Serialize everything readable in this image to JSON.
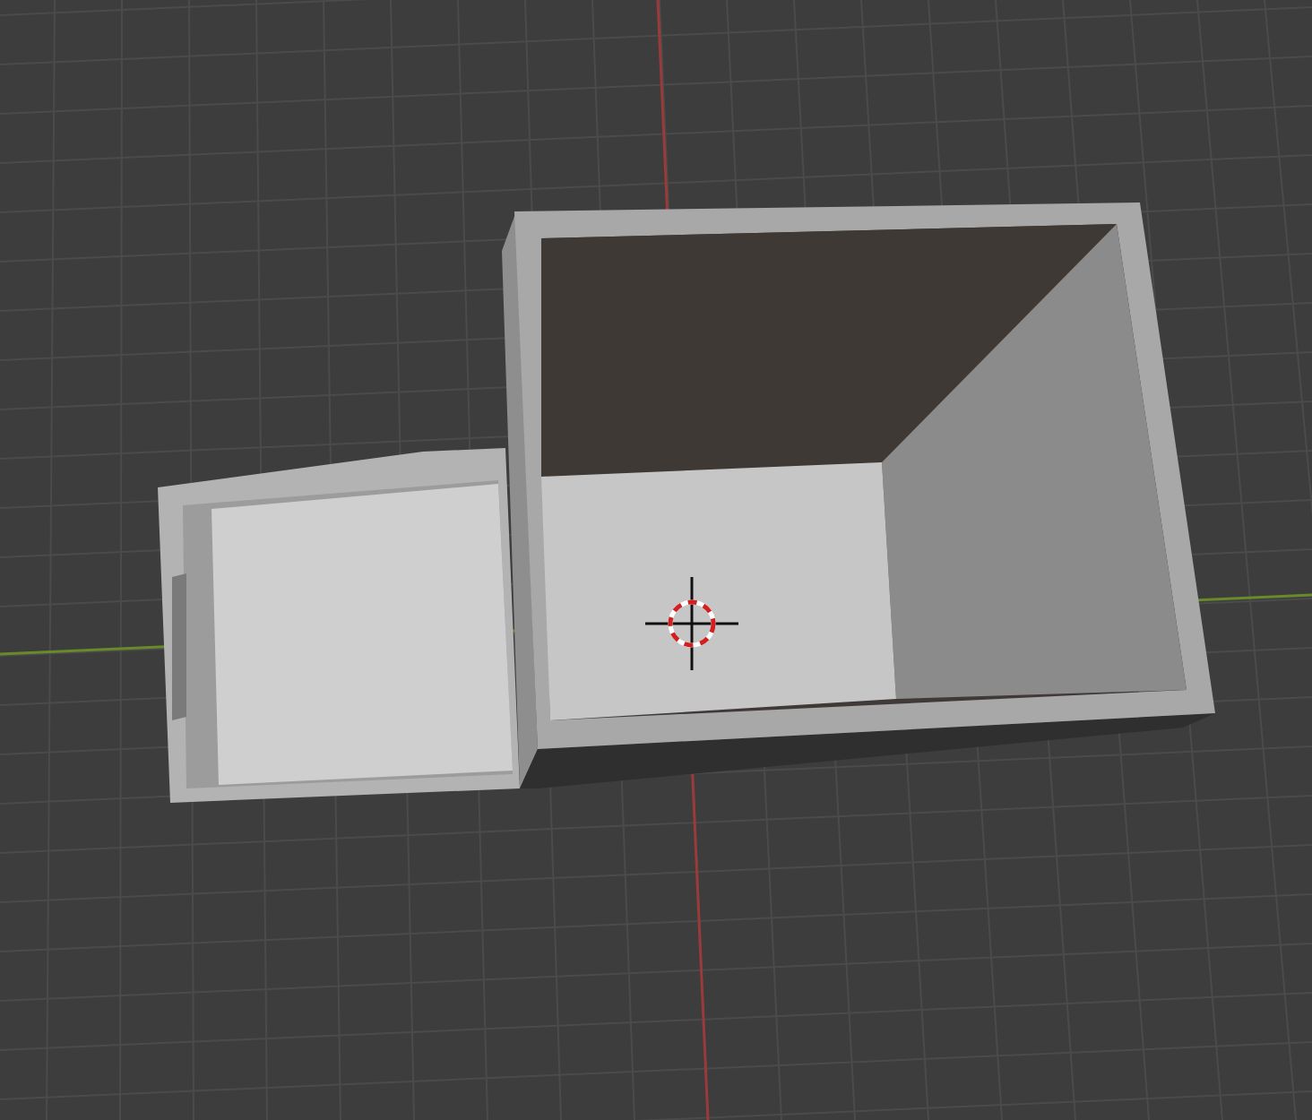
{
  "viewport": {
    "grid_visible": true,
    "x_axis_visible": true,
    "y_axis_visible": true,
    "cursor_visible": true
  }
}
